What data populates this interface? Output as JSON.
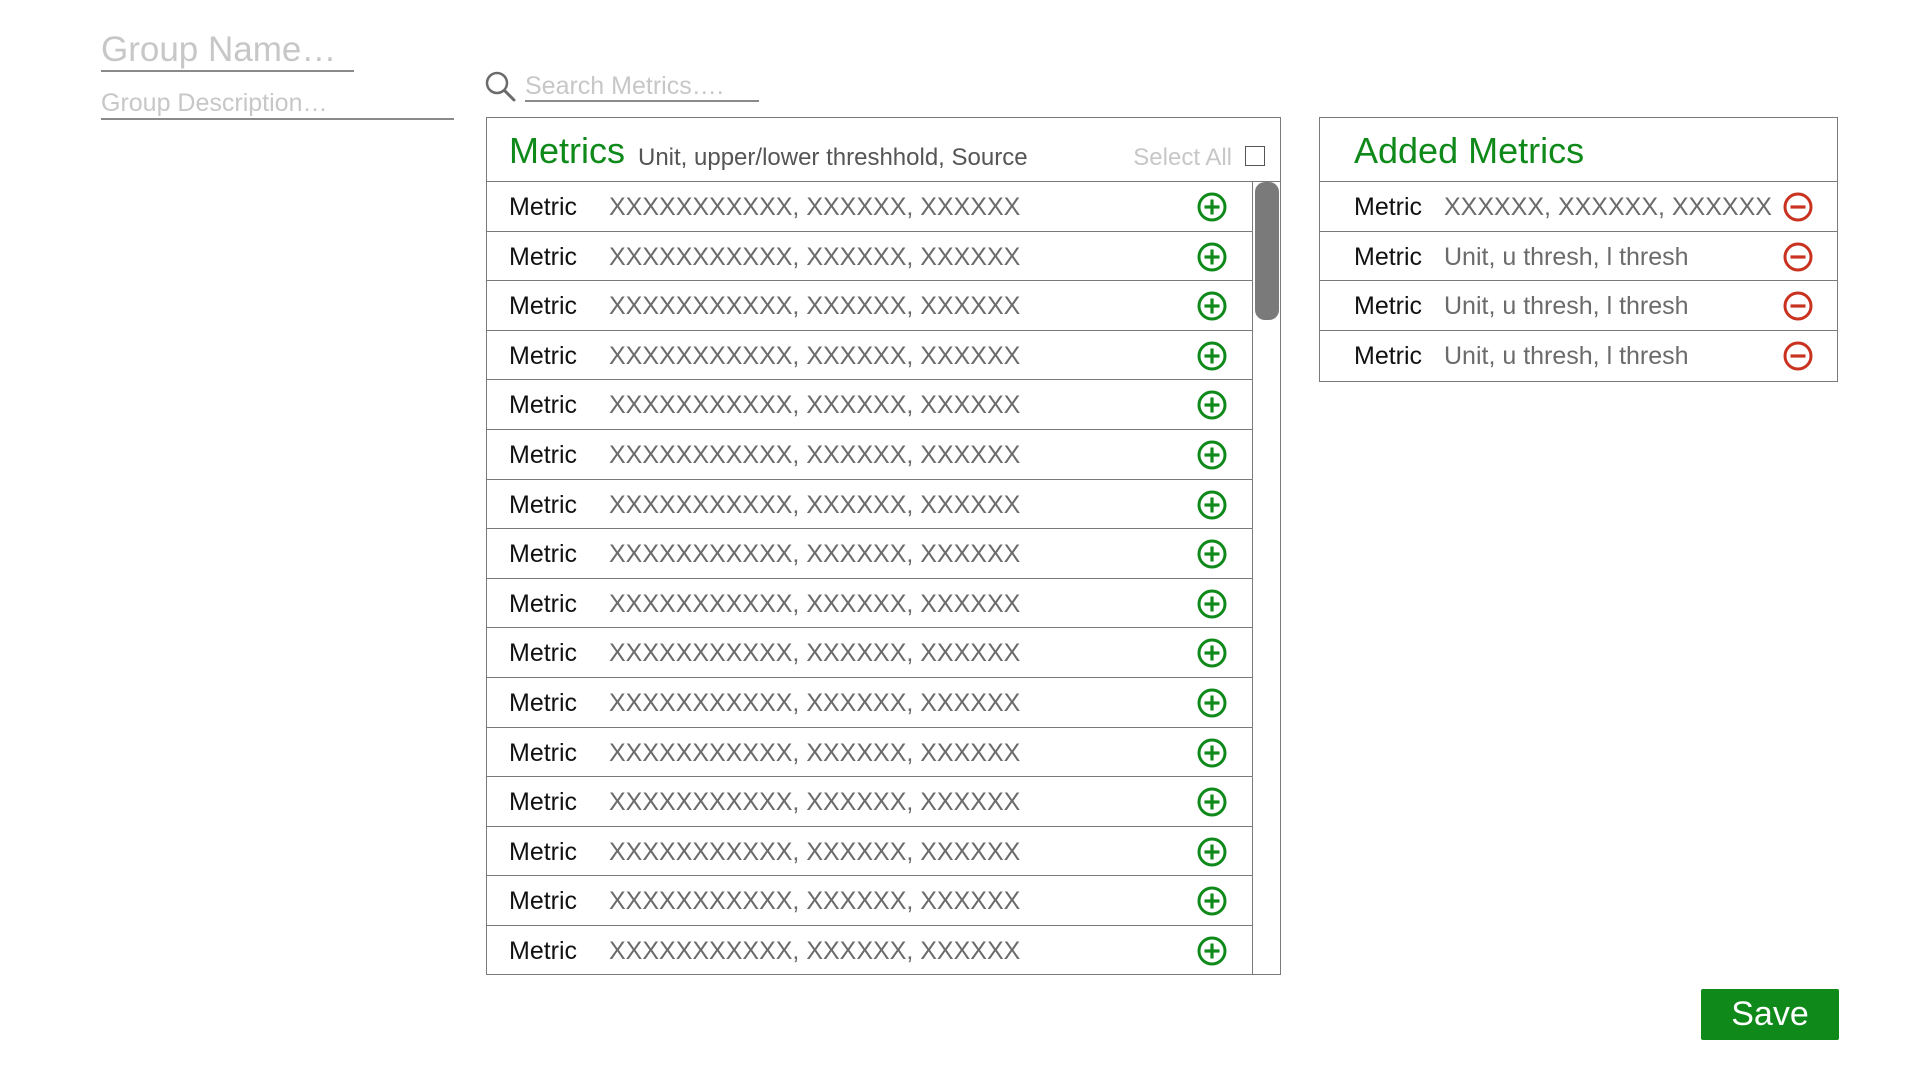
{
  "group": {
    "name_placeholder": "Group Name…",
    "description_placeholder": "Group Description…"
  },
  "search": {
    "placeholder": "Search Metrics…."
  },
  "metrics_panel": {
    "title": "Metrics",
    "subtitle": "Unit, upper/lower threshhold, Source",
    "select_all_label": "Select All",
    "select_all_checked": false,
    "add_icon": "plus-circle-icon",
    "rows": [
      {
        "name": "Metric",
        "details": "XXXXXXXXXXX, XXXXXX, XXXXXX"
      },
      {
        "name": "Metric",
        "details": "XXXXXXXXXXX, XXXXXX, XXXXXX"
      },
      {
        "name": "Metric",
        "details": "XXXXXXXXXXX, XXXXXX, XXXXXX"
      },
      {
        "name": "Metric",
        "details": "XXXXXXXXXXX, XXXXXX, XXXXXX"
      },
      {
        "name": "Metric",
        "details": "XXXXXXXXXXX, XXXXXX, XXXXXX"
      },
      {
        "name": "Metric",
        "details": "XXXXXXXXXXX, XXXXXX, XXXXXX"
      },
      {
        "name": "Metric",
        "details": "XXXXXXXXXXX, XXXXXX, XXXXXX"
      },
      {
        "name": "Metric",
        "details": "XXXXXXXXXXX, XXXXXX, XXXXXX"
      },
      {
        "name": "Metric",
        "details": "XXXXXXXXXXX, XXXXXX, XXXXXX"
      },
      {
        "name": "Metric",
        "details": "XXXXXXXXXXX, XXXXXX, XXXXXX"
      },
      {
        "name": "Metric",
        "details": "XXXXXXXXXXX, XXXXXX, XXXXXX"
      },
      {
        "name": "Metric",
        "details": "XXXXXXXXXXX, XXXXXX, XXXXXX"
      },
      {
        "name": "Metric",
        "details": "XXXXXXXXXXX, XXXXXX, XXXXXX"
      },
      {
        "name": "Metric",
        "details": "XXXXXXXXXXX, XXXXXX, XXXXXX"
      },
      {
        "name": "Metric",
        "details": "XXXXXXXXXXX, XXXXXX, XXXXXX"
      },
      {
        "name": "Metric",
        "details": "XXXXXXXXXXX, XXXXXX, XXXXXX"
      }
    ]
  },
  "added_panel": {
    "title": "Added Metrics",
    "remove_icon": "minus-circle-icon",
    "rows": [
      {
        "name": "Metric",
        "details": "XXXXXX, XXXXXX, XXXXXX"
      },
      {
        "name": "Metric",
        "details": "Unit, u thresh, l thresh"
      },
      {
        "name": "Metric",
        "details": "Unit, u thresh, l thresh"
      },
      {
        "name": "Metric",
        "details": "Unit, u thresh, l thresh"
      }
    ]
  },
  "actions": {
    "save_label": "Save"
  },
  "colors": {
    "accent_green": "#0f8a1a",
    "remove_red": "#c8321e",
    "border_gray": "#7a7a7a",
    "placeholder_gray": "#c7c7c7"
  }
}
